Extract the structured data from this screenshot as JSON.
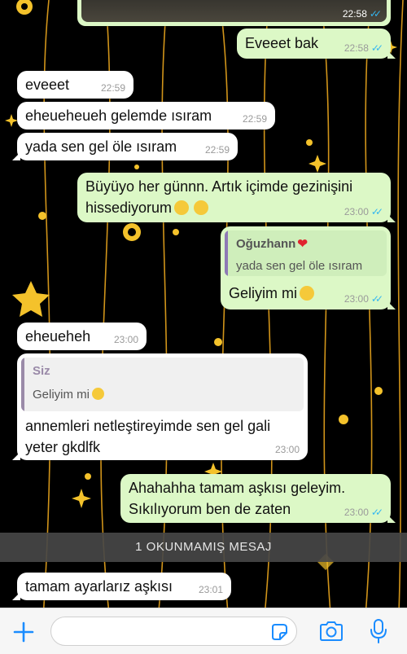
{
  "messages": [
    {
      "id": "m0",
      "direction": "out",
      "time": "22:58",
      "ticks": "✓✓",
      "kind": "image"
    },
    {
      "id": "m1",
      "direction": "out",
      "text": "Eveeet bak",
      "time": "22:58",
      "ticks": "✓✓"
    },
    {
      "id": "m2",
      "direction": "in",
      "text": "eveeet",
      "time": "22:59"
    },
    {
      "id": "m3",
      "direction": "in",
      "text": "eheueheueh gelemde ısıram",
      "time": "22:59"
    },
    {
      "id": "m4",
      "direction": "in",
      "text": "yada sen gel öle ısıram",
      "time": "22:59"
    },
    {
      "id": "m5",
      "direction": "out",
      "lines": [
        "Büyüyo her günnn. Artık içimde gezinişini",
        "hissediyorum"
      ],
      "emoji": [
        "relieved-face-emoji",
        "relieved-face-emoji"
      ],
      "time": "23:00",
      "ticks": "✓✓"
    },
    {
      "id": "m6",
      "direction": "out",
      "quote": {
        "name": "Oğuzhann",
        "name_emoji": "red-heart-emoji",
        "text": "yada sen gel öle ısıram"
      },
      "text": "Geliyim mi",
      "emoji": [
        "slightly-frowning-face-emoji"
      ],
      "time": "23:00",
      "ticks": "✓✓"
    },
    {
      "id": "m7",
      "direction": "in",
      "text": "eheueheh",
      "time": "23:00"
    },
    {
      "id": "m8",
      "direction": "in",
      "quote": {
        "name": "Siz",
        "text": "Geliyim mi",
        "emoji": "slightly-frowning-face-emoji"
      },
      "lines": [
        "annemleri netleştireyimde sen gel gali",
        "yeter gkdlfk"
      ],
      "time": "23:00"
    },
    {
      "id": "m9",
      "direction": "out",
      "lines": [
        "Ahahahha tamam aşkısı geleyim.",
        "Sıkılıyorum ben de zaten"
      ],
      "time": "23:00",
      "ticks": "✓✓"
    },
    {
      "id": "m10",
      "direction": "in",
      "text": "tamam ayarlarız aşkısı",
      "time": "23:01"
    }
  ],
  "unread_banner": "1 OKUNMAMIŞ MESAJ",
  "input_bar": {
    "placeholder": "",
    "icons": [
      "plus-icon",
      "sticker-icon",
      "camera-icon",
      "microphone-icon"
    ]
  },
  "colors": {
    "incoming_bubble": "#ffffff",
    "outgoing_bubble": "#dcf8c6",
    "read_ticks": "#34b7f1",
    "accent_blue": "#1a8cff",
    "wallpaper": "#000000",
    "wallpaper_lines": "#e8a51d",
    "quote_bar_own": "#8e7ab5",
    "quote_bar_other": "#9a8aa8",
    "quote_name_other": "#6c3b2b"
  }
}
